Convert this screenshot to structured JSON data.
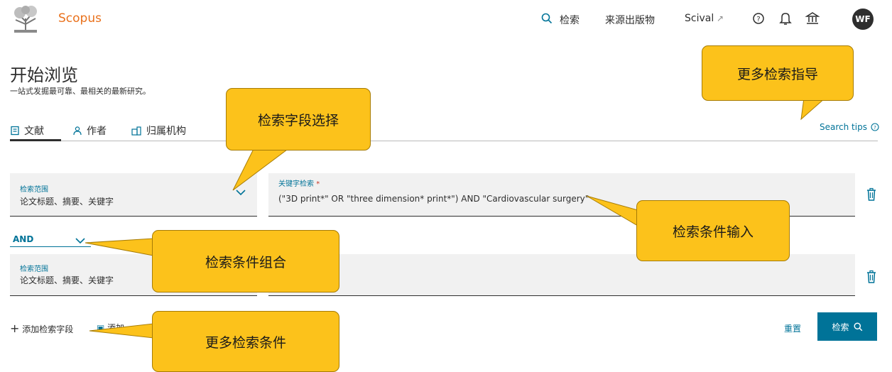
{
  "header": {
    "brand": "Scopus",
    "nav_search": "检索",
    "nav_sources": "来源出版物",
    "nav_scival": "Scival",
    "avatar_initials": "WF"
  },
  "page": {
    "title": "开始浏览",
    "subtitle": "一站式发掘最可靠、最相关的最新研究。"
  },
  "tabs": [
    {
      "label": "文献",
      "icon": "document-icon",
      "active": true
    },
    {
      "label": "作者",
      "icon": "person-icon",
      "active": false
    },
    {
      "label": "归属机构",
      "icon": "building-icon",
      "active": false
    }
  ],
  "search_tips": "Search tips",
  "rows": [
    {
      "scope_label": "检索范围",
      "scope_value": "论文标题、摘要、关键字",
      "keyword_label": "关键字检索",
      "keyword_required": "*",
      "keyword_value": "(\"3D print*\" OR \"three dimension* print*\") AND \"Cardiovascular surgery\""
    },
    {
      "scope_label": "检索范围",
      "scope_value": "论文标题、摘要、关键字",
      "keyword_value": ""
    }
  ],
  "operator": "AND",
  "footer": {
    "add_field": "添加检索字段",
    "add_other": "添加",
    "reset": "重置",
    "search": "检索"
  },
  "callouts": {
    "field_select": "检索字段选择",
    "more_tips": "更多检索指导",
    "condition_input": "检索条件输入",
    "condition_combine": "检索条件组合",
    "more_conditions": "更多检索条件"
  },
  "colors": {
    "brand": "#e9711c",
    "link": "#007398",
    "callout": "#fcc21b"
  }
}
